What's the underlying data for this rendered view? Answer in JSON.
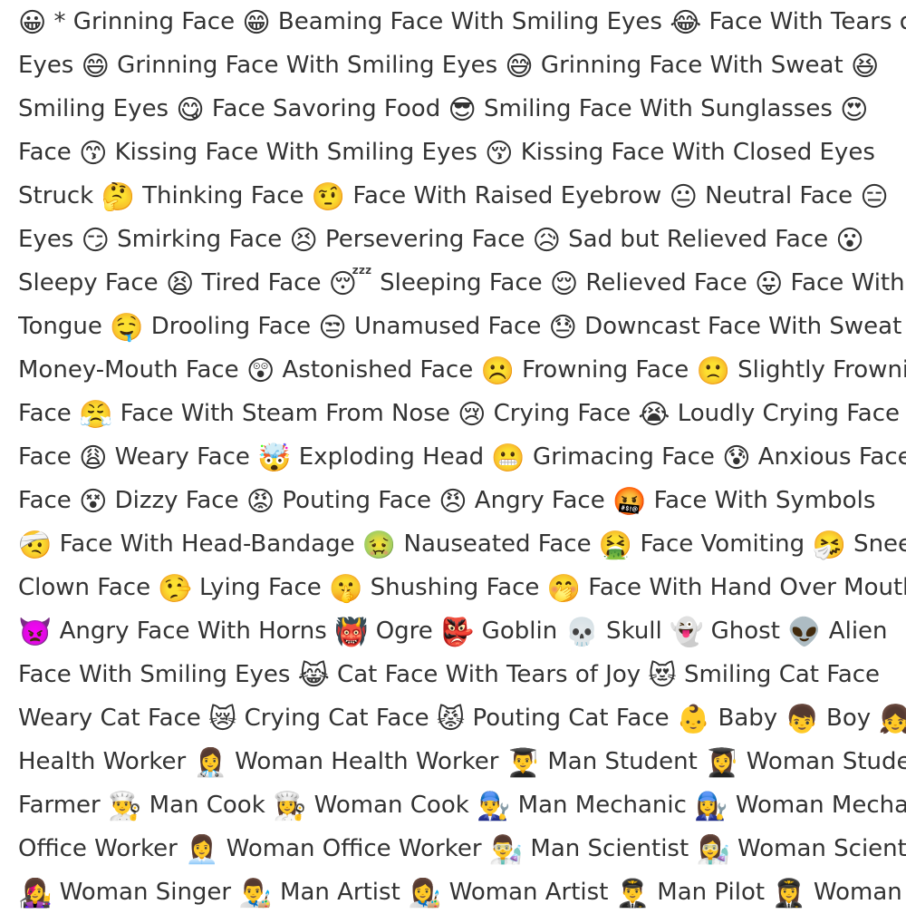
{
  "lines": [
    [
      {
        "e": "😀"
      },
      {
        "t": " * Grinning Face "
      },
      {
        "e": "😁"
      },
      {
        "t": " Beaming Face With Smiling Eyes "
      },
      {
        "e": "😂"
      },
      {
        "t": " Face With Tears of Joy"
      }
    ],
    [
      {
        "t": "Eyes "
      },
      {
        "e": "😄"
      },
      {
        "t": " Grinning Face With Smiling Eyes "
      },
      {
        "e": "😅"
      },
      {
        "t": " Grinning Face With Sweat "
      },
      {
        "e": "😆"
      }
    ],
    [
      {
        "t": "Smiling Eyes "
      },
      {
        "e": "😋"
      },
      {
        "t": " Face Savoring Food "
      },
      {
        "e": "😎"
      },
      {
        "t": " Smiling Face With Sunglasses "
      },
      {
        "e": "😍"
      }
    ],
    [
      {
        "t": "Face "
      },
      {
        "e": "😙"
      },
      {
        "t": " Kissing Face With Smiling Eyes "
      },
      {
        "e": "😚"
      },
      {
        "t": " Kissing Face With Closed Eyes"
      }
    ],
    [
      {
        "t": "Struck "
      },
      {
        "e": "🤔"
      },
      {
        "t": " Thinking Face "
      },
      {
        "e": "🤨"
      },
      {
        "t": " Face With Raised Eyebrow "
      },
      {
        "e": "😐"
      },
      {
        "t": " Neutral Face "
      },
      {
        "e": "😑"
      }
    ],
    [
      {
        "t": "Eyes "
      },
      {
        "e": "😏"
      },
      {
        "t": " Smirking Face "
      },
      {
        "e": "😣"
      },
      {
        "t": " Persevering Face "
      },
      {
        "e": "😥"
      },
      {
        "t": " Sad but Relieved Face "
      },
      {
        "e": "😮"
      }
    ],
    [
      {
        "t": "Sleepy Face "
      },
      {
        "e": "😫"
      },
      {
        "t": " Tired Face "
      },
      {
        "e": "😴"
      },
      {
        "t": " Sleeping Face "
      },
      {
        "e": "😌"
      },
      {
        "t": " Relieved Face "
      },
      {
        "e": "😛"
      },
      {
        "t": " Face With"
      }
    ],
    [
      {
        "t": "Tongue "
      },
      {
        "e": "🤤"
      },
      {
        "t": " Drooling Face "
      },
      {
        "e": "😒"
      },
      {
        "t": " Unamused Face "
      },
      {
        "e": "😓"
      },
      {
        "t": " Downcast Face With Sweat"
      }
    ],
    [
      {
        "t": "Money-Mouth Face "
      },
      {
        "e": "😲"
      },
      {
        "t": " Astonished Face "
      },
      {
        "e": "☹️"
      },
      {
        "t": " Frowning Face "
      },
      {
        "e": "🙁"
      },
      {
        "t": " Slightly Frowning"
      }
    ],
    [
      {
        "t": "Face "
      },
      {
        "e": "😤"
      },
      {
        "t": " Face With Steam From Nose "
      },
      {
        "e": "😢"
      },
      {
        "t": " Crying Face "
      },
      {
        "e": "😭"
      },
      {
        "t": " Loudly Crying Face"
      }
    ],
    [
      {
        "t": "Face "
      },
      {
        "e": "😩"
      },
      {
        "t": " Weary Face "
      },
      {
        "e": "🤯"
      },
      {
        "t": " Exploding Head "
      },
      {
        "e": "😬"
      },
      {
        "t": " Grimacing Face "
      },
      {
        "e": "😰"
      },
      {
        "t": " Anxious Face"
      }
    ],
    [
      {
        "t": "Face "
      },
      {
        "e": "😵"
      },
      {
        "t": " Dizzy Face "
      },
      {
        "e": "😡"
      },
      {
        "t": " Pouting Face "
      },
      {
        "e": "😠"
      },
      {
        "t": " Angry Face "
      },
      {
        "e": "🤬"
      },
      {
        "t": " Face With Symbols"
      }
    ],
    [
      {
        "e": "🤕"
      },
      {
        "t": " Face With Head-Bandage "
      },
      {
        "e": "🤢"
      },
      {
        "t": " Nauseated Face "
      },
      {
        "e": "🤮"
      },
      {
        "t": " Face Vomiting "
      },
      {
        "e": "🤧"
      },
      {
        "t": " Sneezing"
      }
    ],
    [
      {
        "t": "Clown Face "
      },
      {
        "e": "🤥"
      },
      {
        "t": " Lying Face "
      },
      {
        "e": "🤫"
      },
      {
        "t": " Shushing Face "
      },
      {
        "e": "🤭"
      },
      {
        "t": " Face With Hand Over Mouth"
      }
    ],
    [
      {
        "e": "👿"
      },
      {
        "t": " Angry Face With Horns "
      },
      {
        "e": "👹"
      },
      {
        "t": " Ogre "
      },
      {
        "e": "👺"
      },
      {
        "t": " Goblin "
      },
      {
        "e": "💀"
      },
      {
        "t": " Skull "
      },
      {
        "e": "👻"
      },
      {
        "t": " Ghost "
      },
      {
        "e": "👽"
      },
      {
        "t": " Alien"
      }
    ],
    [
      {
        "t": "Face With Smiling Eyes "
      },
      {
        "e": "😹"
      },
      {
        "t": " Cat Face With Tears of Joy "
      },
      {
        "e": "😻"
      },
      {
        "t": " Smiling Cat Face"
      }
    ],
    [
      {
        "t": "Weary Cat Face "
      },
      {
        "e": "😿"
      },
      {
        "t": " Crying Cat Face "
      },
      {
        "e": "😾"
      },
      {
        "t": " Pouting Cat Face "
      },
      {
        "e": "👶"
      },
      {
        "t": " Baby "
      },
      {
        "e": "👦"
      },
      {
        "t": " Boy "
      },
      {
        "e": "👧"
      }
    ],
    [
      {
        "t": "Health Worker "
      },
      {
        "e": "👩‍⚕️"
      },
      {
        "t": " Woman Health Worker "
      },
      {
        "e": "👨‍🎓"
      },
      {
        "t": " Man Student "
      },
      {
        "e": "👩‍🎓"
      },
      {
        "t": " Woman Student"
      }
    ],
    [
      {
        "t": "Farmer "
      },
      {
        "e": "👨‍🍳"
      },
      {
        "t": " Man Cook "
      },
      {
        "e": "👩‍🍳"
      },
      {
        "t": " Woman Cook "
      },
      {
        "e": "👨‍🔧"
      },
      {
        "t": " Man Mechanic "
      },
      {
        "e": "👩‍🔧"
      },
      {
        "t": " Woman Mechanic"
      }
    ],
    [
      {
        "t": "Office Worker "
      },
      {
        "e": "👩‍💼"
      },
      {
        "t": " Woman Office Worker "
      },
      {
        "e": "👨‍🔬"
      },
      {
        "t": " Man Scientist "
      },
      {
        "e": "👩‍🔬"
      },
      {
        "t": " Woman Scientist"
      }
    ],
    [
      {
        "e": "👩‍🎤"
      },
      {
        "t": " Woman Singer "
      },
      {
        "e": "👨‍🎨"
      },
      {
        "t": " Man Artist "
      },
      {
        "e": "👩‍🎨"
      },
      {
        "t": " Woman Artist "
      },
      {
        "e": "👨‍✈️"
      },
      {
        "t": " Man Pilot "
      },
      {
        "e": "👩‍✈️"
      },
      {
        "t": " Woman"
      }
    ]
  ]
}
